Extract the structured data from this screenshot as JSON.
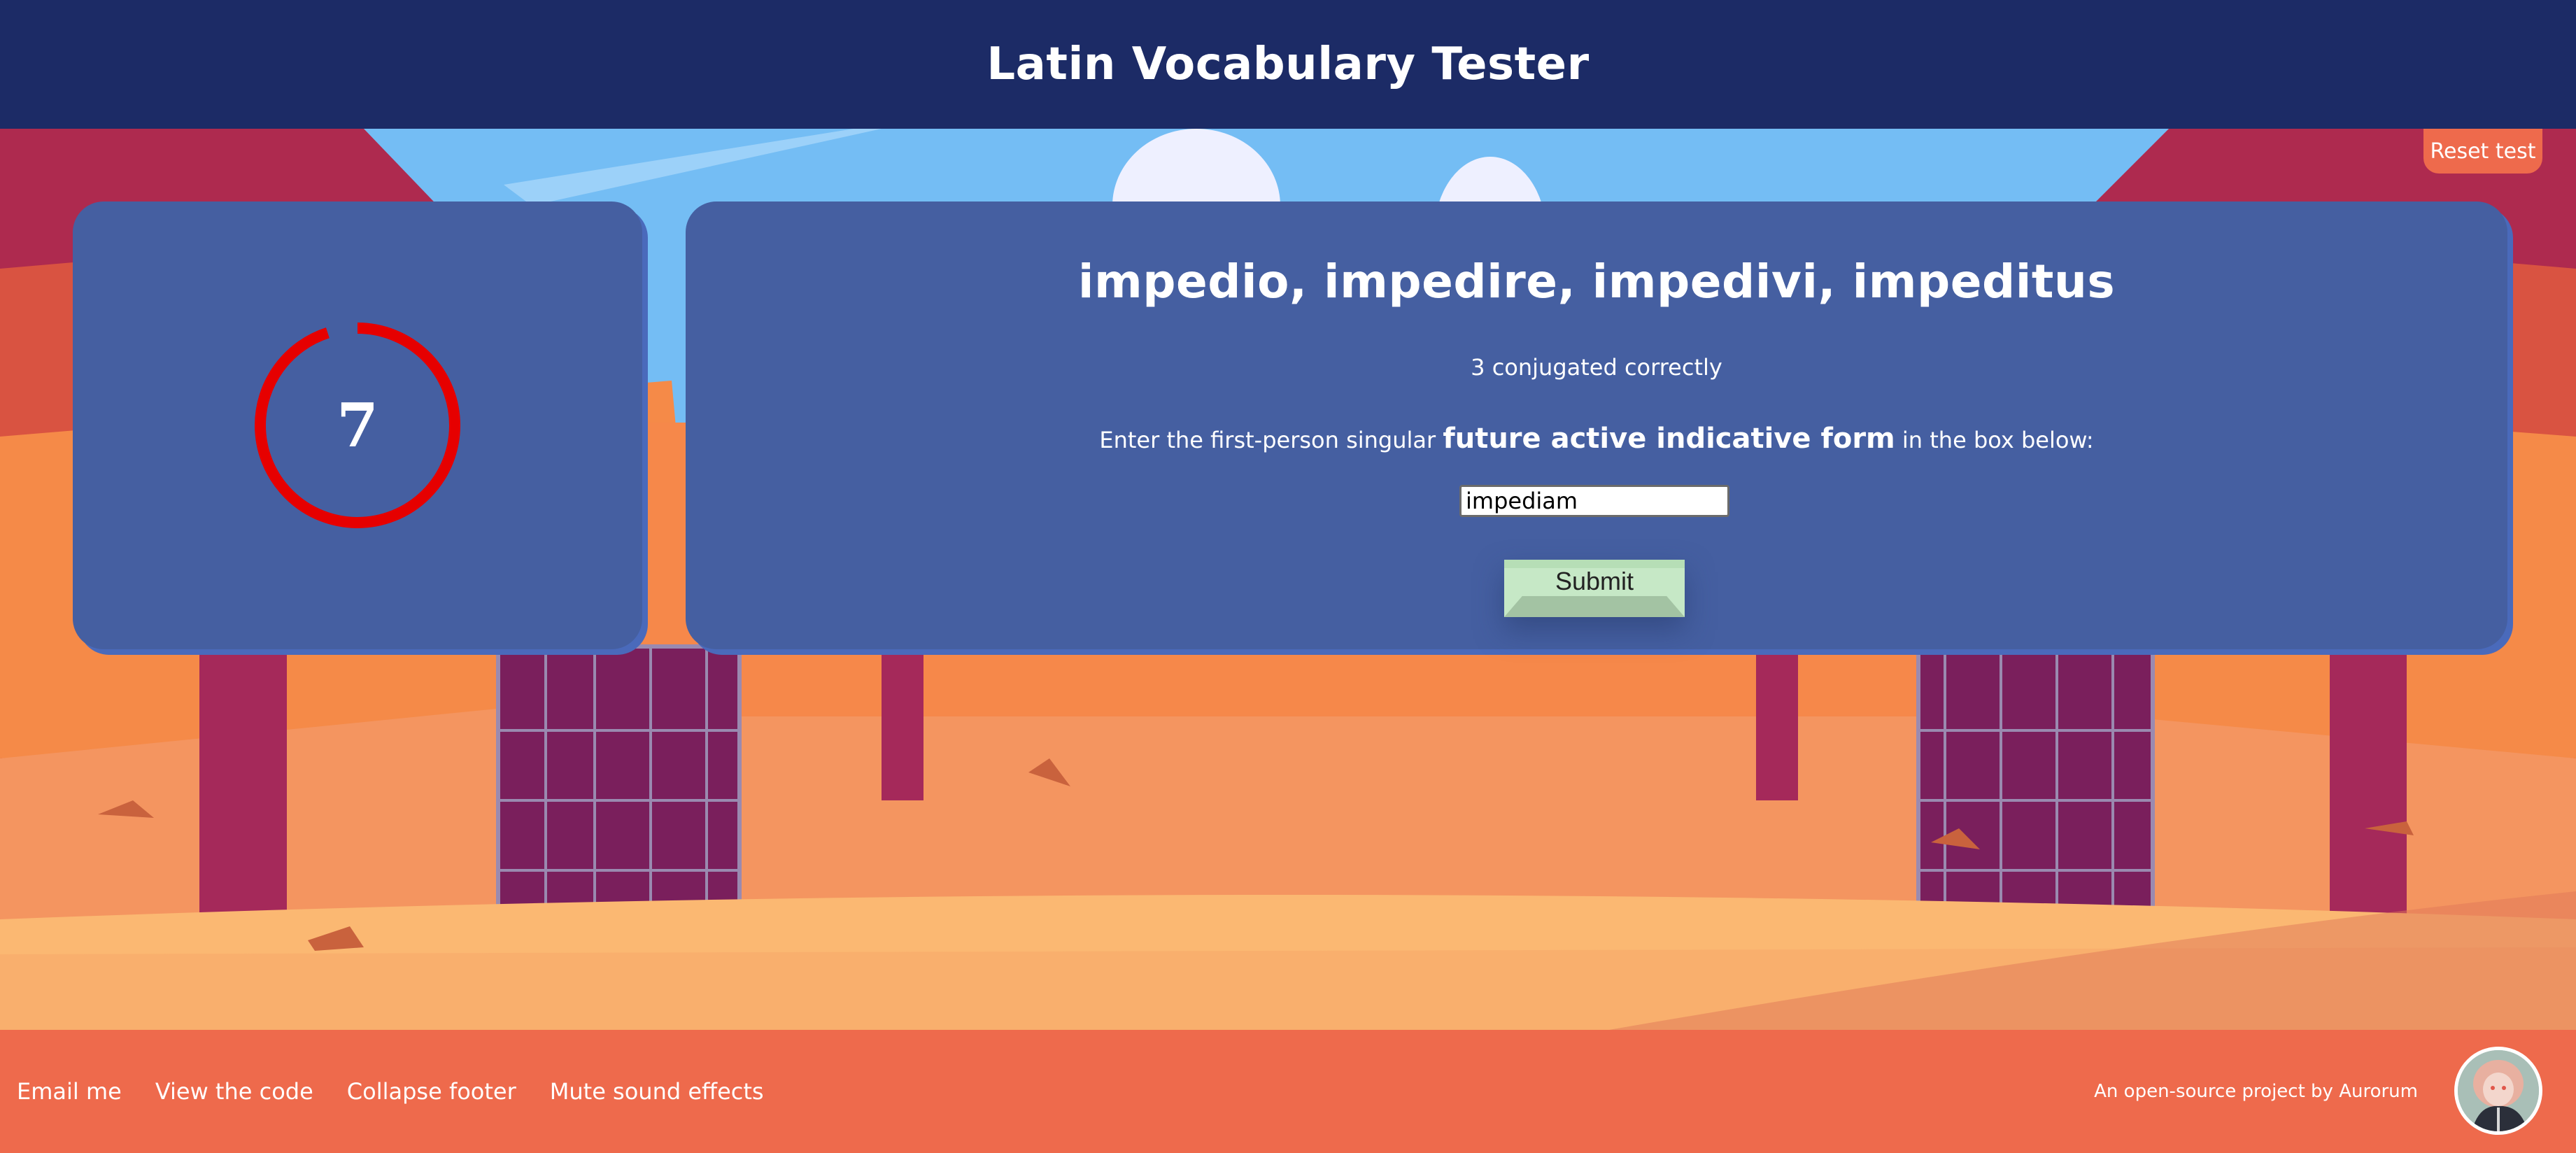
{
  "header": {
    "title": "Latin Vocabulary Tester"
  },
  "toolbar": {
    "reset_label": "Reset test"
  },
  "timer": {
    "value": "7",
    "remaining_fraction": 0.95,
    "ring_color": "#e60000"
  },
  "question": {
    "principal_parts": "impedio, impedire, impedivi, impeditus",
    "correct_count_text": "3 conjugated correctly",
    "instruction_prefix": "Enter the first-person singular",
    "instruction_form": "future active indicative form",
    "instruction_suffix": "in the box below:",
    "answer_value": "impediam",
    "submit_label": "Submit"
  },
  "footer": {
    "links": [
      {
        "label": "Email me"
      },
      {
        "label": "View the code"
      },
      {
        "label": "Collapse footer"
      },
      {
        "label": "Mute sound effects"
      }
    ],
    "credit": "An open-source project by Aurorum"
  },
  "colors": {
    "header_bg": "#1c2b66",
    "card_bg": "#455fa1",
    "accent": "#ee6a4c",
    "submit_bg": "#c6e8c6"
  }
}
